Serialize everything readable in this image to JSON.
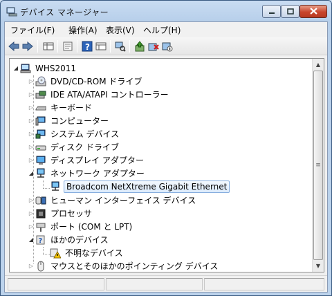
{
  "window": {
    "title": "デバイス マネージャー"
  },
  "menubar": {
    "items": [
      {
        "label": "ファイル(F)"
      },
      {
        "label": "操作(A)"
      },
      {
        "label": "表示(V)"
      },
      {
        "label": "ヘルプ(H)"
      }
    ]
  },
  "toolbar": {
    "icons": [
      "back-arrow-icon",
      "forward-arrow-icon",
      "grid-view-icon",
      "properties-icon",
      "help-icon",
      "list-view-icon",
      "scan-hardware-icon",
      "update-driver-icon",
      "uninstall-icon",
      "disable-icon"
    ]
  },
  "tree": {
    "root": {
      "label": "WHS2011"
    },
    "items": [
      {
        "label": "DVD/CD-ROM ドライブ",
        "icon": "dvd-drive-icon"
      },
      {
        "label": "IDE ATA/ATAPI コントローラー",
        "icon": "ide-controller-icon"
      },
      {
        "label": "キーボード",
        "icon": "keyboard-icon"
      },
      {
        "label": "コンピューター",
        "icon": "computer-icon"
      },
      {
        "label": "システム デバイス",
        "icon": "system-device-icon"
      },
      {
        "label": "ディスク ドライブ",
        "icon": "disk-drive-icon"
      },
      {
        "label": "ディスプレイ アダプター",
        "icon": "display-adapter-icon"
      },
      {
        "label": "ネットワーク アダプター",
        "icon": "network-adapter-icon"
      },
      {
        "label": "Broadcom NetXtreme Gigabit Ethernet",
        "icon": "network-card-icon"
      },
      {
        "label": "ヒューマン インターフェイス デバイス",
        "icon": "hid-icon"
      },
      {
        "label": "プロセッサ",
        "icon": "processor-icon"
      },
      {
        "label": "ポート (COM と LPT)",
        "icon": "port-icon"
      },
      {
        "label": "ほかのデバイス",
        "icon": "other-devices-icon"
      },
      {
        "label": "不明なデバイス",
        "icon": "unknown-device-warning-icon"
      },
      {
        "label": "マウスとそのほかのポインティング デバイス",
        "icon": "mouse-icon"
      }
    ]
  },
  "colors": {
    "selection_border": "#84acdd",
    "close_button": "#c8452c"
  }
}
